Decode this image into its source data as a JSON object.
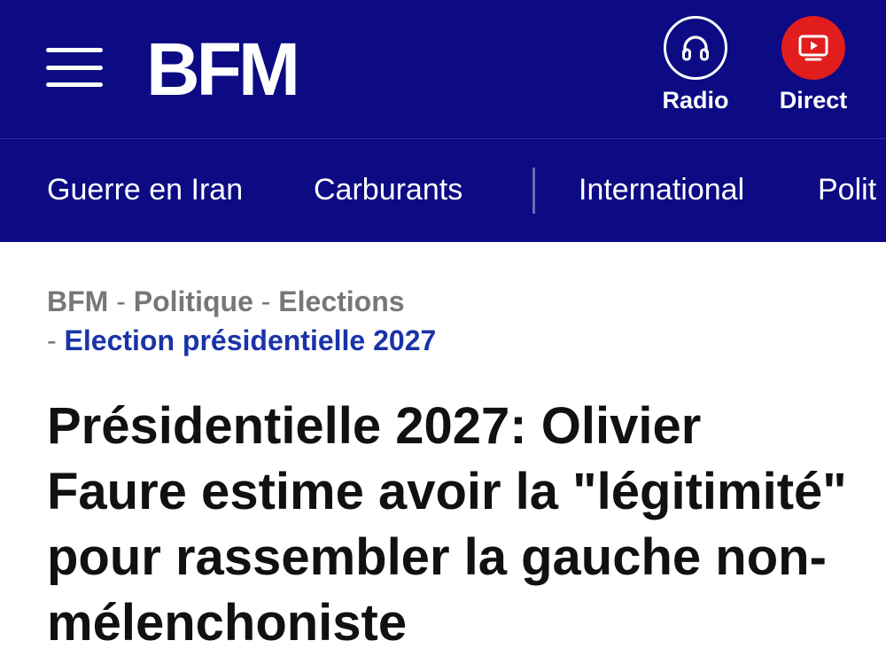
{
  "header": {
    "logo_text": "BFM",
    "radio_label": "Radio",
    "direct_label": "Direct",
    "background_color": "#0c0b84",
    "direct_accent": "#e11d1d",
    "icons": [
      "menu-icon",
      "headphones-icon",
      "tv-play-icon"
    ]
  },
  "nav": {
    "items": [
      "Guerre en Iran",
      "Carburants",
      "International",
      "Polit"
    ]
  },
  "breadcrumb": {
    "items": [
      "BFM",
      "Politique",
      "Elections",
      "Election présidentielle 2027"
    ],
    "separator": "-",
    "current_color": "#1a33a8"
  },
  "article": {
    "headline": "Présidentielle 2027: Olivier Faure estime avoir la \"légitimité\" pour rassembler la gauche non-mélenchoniste"
  }
}
